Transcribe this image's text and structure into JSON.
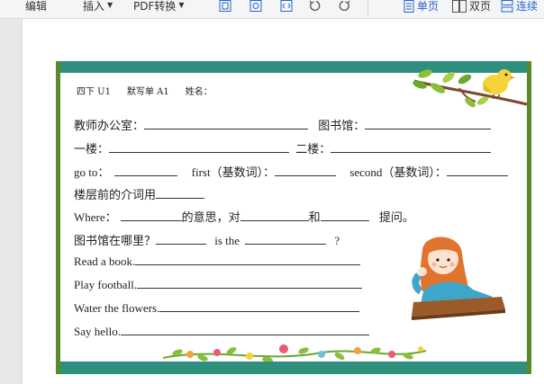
{
  "toolbar": {
    "edit": "编辑",
    "insert": "插入",
    "pdf": "PDF转换",
    "single_page": "单页",
    "double_page": "双页",
    "continuous": "连续"
  },
  "worksheet": {
    "header": [
      "四下 U1",
      "默写单 A1",
      "姓名："
    ],
    "lines": [
      {
        "text": "教师办公室：",
        "text2": "图书馆："
      },
      {
        "text": "一楼：",
        "text2": "二楼："
      },
      {
        "text": "go to：",
        "text2": "first（基数词）：",
        "text3": "second（基数词）："
      },
      {
        "text": "楼层前的介词用"
      },
      {
        "text": "Where：",
        "text2": "的意思，对",
        "text3": "和",
        "text4": "提问。"
      },
      {
        "text": "图书馆在哪里？",
        "text2": "is the",
        "text3": "?"
      },
      {
        "text": "Read a book."
      },
      {
        "text": "Play football."
      },
      {
        "text": "Water the flowers."
      },
      {
        "text": "Say hello."
      }
    ]
  },
  "colors": {
    "band": "#2e8f7e",
    "border": "#5a8a2a",
    "accent": "#2a63c8"
  }
}
